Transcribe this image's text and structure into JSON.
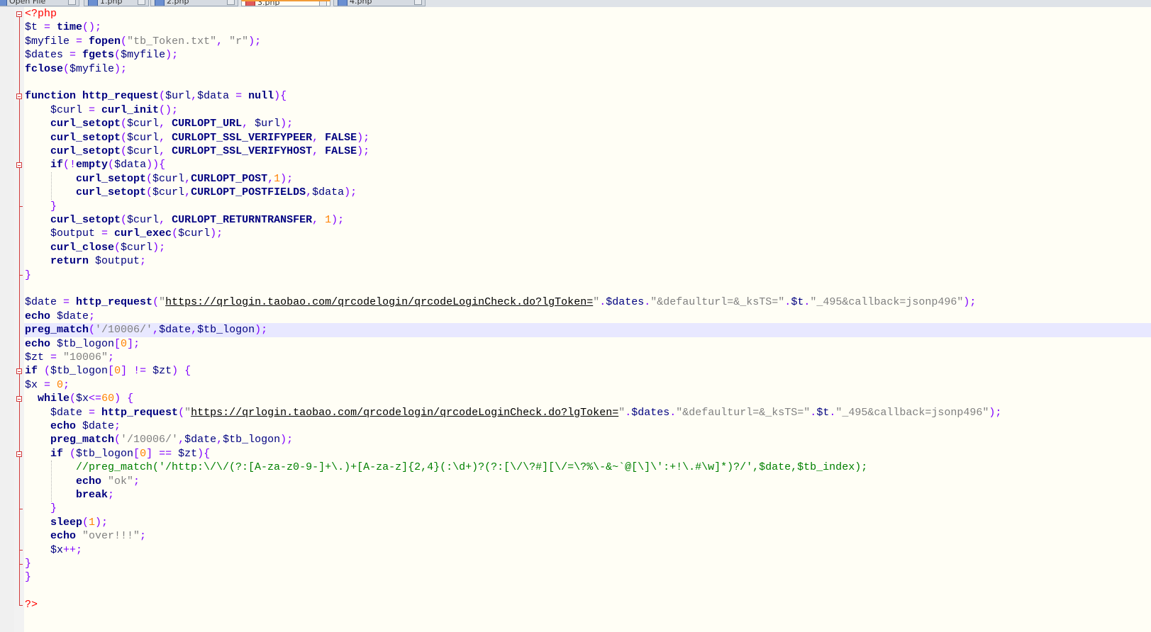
{
  "tabs": [
    {
      "label": "Open File",
      "active": false
    },
    {
      "label": "1.php",
      "active": false
    },
    {
      "label": "2.php",
      "active": false
    },
    {
      "label": "3.php",
      "active": true
    },
    {
      "label": "4.php",
      "active": false
    }
  ],
  "colors": {
    "editor_background": "#fffef5",
    "current_line": "#e8e8ff",
    "keyword": "#000080",
    "operator": "#8000ff",
    "string": "#808080",
    "number": "#ff8000",
    "comment": "#008000",
    "php_tag": "#ff0000",
    "fold_marker": "#d23a3a"
  },
  "editor": {
    "language": "php",
    "current_line": 23,
    "lines": [
      [
        [
          "php",
          "<?php"
        ]
      ],
      [
        [
          "var",
          "$t "
        ],
        [
          "op",
          "= "
        ],
        [
          "kw",
          "time"
        ],
        [
          "op",
          "();"
        ]
      ],
      [
        [
          "var",
          "$myfile "
        ],
        [
          "op",
          "= "
        ],
        [
          "kw",
          "fopen"
        ],
        [
          "op",
          "("
        ],
        [
          "str",
          "\"tb_Token.txt\""
        ],
        [
          "op",
          ", "
        ],
        [
          "str",
          "\"r\""
        ],
        [
          "op",
          ");"
        ]
      ],
      [
        [
          "var",
          "$dates "
        ],
        [
          "op",
          "= "
        ],
        [
          "kw",
          "fgets"
        ],
        [
          "op",
          "("
        ],
        [
          "var",
          "$myfile"
        ],
        [
          "op",
          ");"
        ]
      ],
      [
        [
          "kw",
          "fclose"
        ],
        [
          "op",
          "("
        ],
        [
          "var",
          "$myfile"
        ],
        [
          "op",
          ");"
        ]
      ],
      [],
      [
        [
          "kw",
          "function "
        ],
        [
          "kw",
          "http_request"
        ],
        [
          "op",
          "("
        ],
        [
          "var",
          "$url"
        ],
        [
          "op",
          ","
        ],
        [
          "var",
          "$data "
        ],
        [
          "op",
          "= "
        ],
        [
          "kw",
          "null"
        ],
        [
          "op",
          "){"
        ]
      ],
      [
        [
          "var",
          "    $curl "
        ],
        [
          "op",
          "= "
        ],
        [
          "kw",
          "curl_init"
        ],
        [
          "op",
          "();"
        ]
      ],
      [
        [
          "kw",
          "    curl_setopt"
        ],
        [
          "op",
          "("
        ],
        [
          "var",
          "$curl"
        ],
        [
          "op",
          ", "
        ],
        [
          "kw",
          "CURLOPT_URL"
        ],
        [
          "op",
          ", "
        ],
        [
          "var",
          "$url"
        ],
        [
          "op",
          ");"
        ]
      ],
      [
        [
          "kw",
          "    curl_setopt"
        ],
        [
          "op",
          "("
        ],
        [
          "var",
          "$curl"
        ],
        [
          "op",
          ", "
        ],
        [
          "kw",
          "CURLOPT_SSL_VERIFYPEER"
        ],
        [
          "op",
          ", "
        ],
        [
          "kw",
          "FALSE"
        ],
        [
          "op",
          ");"
        ]
      ],
      [
        [
          "kw",
          "    curl_setopt"
        ],
        [
          "op",
          "("
        ],
        [
          "var",
          "$curl"
        ],
        [
          "op",
          ", "
        ],
        [
          "kw",
          "CURLOPT_SSL_VERIFYHOST"
        ],
        [
          "op",
          ", "
        ],
        [
          "kw",
          "FALSE"
        ],
        [
          "op",
          ");"
        ]
      ],
      [
        [
          "kw",
          "    if"
        ],
        [
          "op",
          "(!"
        ],
        [
          "kw",
          "empty"
        ],
        [
          "op",
          "("
        ],
        [
          "var",
          "$data"
        ],
        [
          "op",
          "))"
        ],
        [
          "op",
          "{"
        ]
      ],
      [
        [
          "kw",
          "        curl_setopt"
        ],
        [
          "op",
          "("
        ],
        [
          "var",
          "$curl"
        ],
        [
          "op",
          ","
        ],
        [
          "kw",
          "CURLOPT_POST"
        ],
        [
          "op",
          ","
        ],
        [
          "num",
          "1"
        ],
        [
          "op",
          ");"
        ]
      ],
      [
        [
          "kw",
          "        curl_setopt"
        ],
        [
          "op",
          "("
        ],
        [
          "var",
          "$curl"
        ],
        [
          "op",
          ","
        ],
        [
          "kw",
          "CURLOPT_POSTFIELDS"
        ],
        [
          "op",
          ","
        ],
        [
          "var",
          "$data"
        ],
        [
          "op",
          ");"
        ]
      ],
      [
        [
          "op",
          "    }"
        ]
      ],
      [
        [
          "kw",
          "    curl_setopt"
        ],
        [
          "op",
          "("
        ],
        [
          "var",
          "$curl"
        ],
        [
          "op",
          ", "
        ],
        [
          "kw",
          "CURLOPT_RETURNTRANSFER"
        ],
        [
          "op",
          ", "
        ],
        [
          "num",
          "1"
        ],
        [
          "op",
          ");"
        ]
      ],
      [
        [
          "var",
          "    $output "
        ],
        [
          "op",
          "= "
        ],
        [
          "kw",
          "curl_exec"
        ],
        [
          "op",
          "("
        ],
        [
          "var",
          "$curl"
        ],
        [
          "op",
          ");"
        ]
      ],
      [
        [
          "kw",
          "    curl_close"
        ],
        [
          "op",
          "("
        ],
        [
          "var",
          "$curl"
        ],
        [
          "op",
          ");"
        ]
      ],
      [
        [
          "kw",
          "    return "
        ],
        [
          "var",
          "$output"
        ],
        [
          "op",
          ";"
        ]
      ],
      [
        [
          "op",
          "}"
        ]
      ],
      [],
      [
        [
          "var",
          "$date "
        ],
        [
          "op",
          "= "
        ],
        [
          "kw",
          "http_request"
        ],
        [
          "op",
          "("
        ],
        [
          "str",
          "\""
        ],
        [
          "url",
          "https://qrlogin.taobao.com/qrcodelogin/qrcodeLoginCheck.do?lgToken="
        ],
        [
          "str",
          "\""
        ],
        [
          "op",
          "."
        ],
        [
          "var",
          "$dates"
        ],
        [
          "op",
          "."
        ],
        [
          "str",
          "\"&defaulturl=&_ksTS=\""
        ],
        [
          "op",
          "."
        ],
        [
          "var",
          "$t"
        ],
        [
          "op",
          "."
        ],
        [
          "str",
          "\"_495&callback=jsonp496\""
        ],
        [
          "op",
          ");"
        ]
      ],
      [
        [
          "kw",
          "echo "
        ],
        [
          "var",
          "$date"
        ],
        [
          "op",
          ";"
        ]
      ],
      [
        [
          "kw",
          "preg_match"
        ],
        [
          "op",
          "("
        ],
        [
          "str",
          "'/10006/'"
        ],
        [
          "op",
          ","
        ],
        [
          "var",
          "$date"
        ],
        [
          "op",
          ","
        ],
        [
          "var",
          "$tb_logon"
        ],
        [
          "op",
          ");"
        ]
      ],
      [
        [
          "kw",
          "echo "
        ],
        [
          "var",
          "$tb_logon"
        ],
        [
          "op",
          "["
        ],
        [
          "num",
          "0"
        ],
        [
          "op",
          "];"
        ]
      ],
      [
        [
          "var",
          "$zt "
        ],
        [
          "op",
          "= "
        ],
        [
          "str",
          "\"10006\""
        ],
        [
          "op",
          ";"
        ]
      ],
      [
        [
          "kw",
          "if "
        ],
        [
          "op",
          "("
        ],
        [
          "var",
          "$tb_logon"
        ],
        [
          "op",
          "["
        ],
        [
          "num",
          "0"
        ],
        [
          "op",
          "] "
        ],
        [
          "op",
          "!= "
        ],
        [
          "var",
          "$zt"
        ],
        [
          "op",
          ") {"
        ]
      ],
      [
        [
          "var",
          "$x "
        ],
        [
          "op",
          "= "
        ],
        [
          "num",
          "0"
        ],
        [
          "op",
          ";"
        ]
      ],
      [
        [
          "kw",
          "  while"
        ],
        [
          "op",
          "("
        ],
        [
          "var",
          "$x"
        ],
        [
          "op",
          "<="
        ],
        [
          "num",
          "60"
        ],
        [
          "op",
          ") {"
        ]
      ],
      [
        [
          "var",
          "    $date "
        ],
        [
          "op",
          "= "
        ],
        [
          "kw",
          "http_request"
        ],
        [
          "op",
          "("
        ],
        [
          "str",
          "\""
        ],
        [
          "url",
          "https://qrlogin.taobao.com/qrcodelogin/qrcodeLoginCheck.do?lgToken="
        ],
        [
          "str",
          "\""
        ],
        [
          "op",
          "."
        ],
        [
          "var",
          "$dates"
        ],
        [
          "op",
          "."
        ],
        [
          "str",
          "\"&defaulturl=&_ksTS=\""
        ],
        [
          "op",
          "."
        ],
        [
          "var",
          "$t"
        ],
        [
          "op",
          "."
        ],
        [
          "str",
          "\"_495&callback=jsonp496\""
        ],
        [
          "op",
          ");"
        ]
      ],
      [
        [
          "kw",
          "    echo "
        ],
        [
          "var",
          "$date"
        ],
        [
          "op",
          ";"
        ]
      ],
      [
        [
          "kw",
          "    preg_match"
        ],
        [
          "op",
          "("
        ],
        [
          "str",
          "'/10006/'"
        ],
        [
          "op",
          ","
        ],
        [
          "var",
          "$date"
        ],
        [
          "op",
          ","
        ],
        [
          "var",
          "$tb_logon"
        ],
        [
          "op",
          ");"
        ]
      ],
      [
        [
          "kw",
          "    if "
        ],
        [
          "op",
          "("
        ],
        [
          "var",
          "$tb_logon"
        ],
        [
          "op",
          "["
        ],
        [
          "num",
          "0"
        ],
        [
          "op",
          "] "
        ],
        [
          "op",
          "== "
        ],
        [
          "var",
          "$zt"
        ],
        [
          "op",
          "){"
        ]
      ],
      [
        [
          "cmt",
          "        //preg_match('/http:\\/\\/(?:[A-za-z0-9-]+\\.)+[A-za-z]{2,4}(:\\d+)?(?:[\\/\\?#][\\/=\\?%\\-&~`@[\\]\\':+!\\.#\\w]*)?/',$date,$tb_index);"
        ]
      ],
      [
        [
          "kw",
          "        echo "
        ],
        [
          "str",
          "\"ok\""
        ],
        [
          "op",
          ";"
        ]
      ],
      [
        [
          "kw",
          "        break"
        ],
        [
          "op",
          ";"
        ]
      ],
      [
        [
          "op",
          "    }"
        ]
      ],
      [
        [
          "kw",
          "    sleep"
        ],
        [
          "op",
          "("
        ],
        [
          "num",
          "1"
        ],
        [
          "op",
          ");"
        ]
      ],
      [
        [
          "kw",
          "    echo "
        ],
        [
          "str",
          "\"over!!!\""
        ],
        [
          "op",
          ";"
        ]
      ],
      [
        [
          "var",
          "    $x"
        ],
        [
          "op",
          "++;"
        ]
      ],
      [
        [
          "op",
          "}"
        ]
      ],
      [
        [
          "op",
          "}"
        ]
      ],
      [],
      [
        [
          "php",
          "?>"
        ]
      ]
    ]
  }
}
